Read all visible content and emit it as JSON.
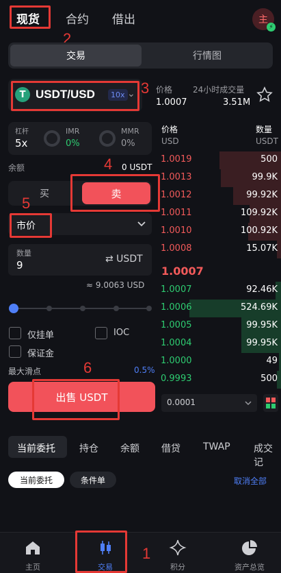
{
  "topnav": {
    "spot": "现货",
    "contract": "合约",
    "lending": "借出",
    "avatar": "主",
    "avatar_badge": "⚡"
  },
  "segment": {
    "trade": "交易",
    "chart": "行情图"
  },
  "pair": {
    "coin_letter": "T",
    "name": "USDT/USD",
    "leverage": "10x",
    "chevron": "⌄"
  },
  "market_info": {
    "price_label": "价格",
    "price": "1.0007",
    "vol_label": "24小时成交量",
    "vol": "3.51M",
    "star_icon": "star-icon"
  },
  "leverage_box": {
    "label": "杠杆",
    "value": "5x",
    "imr_label": "IMR",
    "imr": "0%",
    "mmr_label": "MMR",
    "mmr": "0%"
  },
  "balance": {
    "label": "余额",
    "value": "0 USDT"
  },
  "side": {
    "buy": "买",
    "sell": "卖"
  },
  "order_type": {
    "value": "市价"
  },
  "quantity": {
    "label": "数量",
    "value": "9",
    "unit": "⇄ USDT",
    "approx": "≈ 9.0063 USD"
  },
  "options": {
    "post_only": "仅挂单",
    "ioc": "IOC",
    "margin": "保证金",
    "slippage_label": "最大滑点",
    "slippage": "0.5%"
  },
  "submit": {
    "label": "出售 USDT"
  },
  "orderbook": {
    "price_header": "价格",
    "price_unit": "USD",
    "qty_header": "数量",
    "qty_unit": "USDT",
    "asks": [
      {
        "price": "1.0019",
        "qty": "500"
      },
      {
        "price": "1.0013",
        "qty": "99.9K"
      },
      {
        "price": "1.0012",
        "qty": "99.92K"
      },
      {
        "price": "1.0011",
        "qty": "109.92K"
      },
      {
        "price": "1.0010",
        "qty": "100.92K"
      },
      {
        "price": "1.0008",
        "qty": "15.07K"
      }
    ],
    "mid": "1.0007",
    "bids": [
      {
        "price": "1.0007",
        "qty": "92.46K"
      },
      {
        "price": "1.0006",
        "qty": "524.69K"
      },
      {
        "price": "1.0005",
        "qty": "99.95K"
      },
      {
        "price": "1.0004",
        "qty": "99.95K"
      },
      {
        "price": "1.0000",
        "qty": "49"
      },
      {
        "price": "0.9993",
        "qty": "500"
      }
    ],
    "tick_size": "0.0001"
  },
  "bottom_tabs": {
    "open_orders": "当前委托",
    "positions": "持仓",
    "balance": "余额",
    "loans": "借贷",
    "twap": "TWAP",
    "fills": "成交记"
  },
  "sub_tabs": {
    "open": "当前委托",
    "conditional": "条件单",
    "cancel_all": "取消全部"
  },
  "bnav": {
    "home": "主页",
    "trade": "交易",
    "points": "积分",
    "assets": "资产总览"
  },
  "annotations": {
    "a1": "1",
    "a2": "2",
    "a3": "3",
    "a4": "4",
    "a5": "5",
    "a6": "6"
  },
  "colors": {
    "sell": "#f2525a",
    "buy_green": "#2ecc71",
    "ask_red": "#f25a5a",
    "accent": "#4f7ff7",
    "annotation": "#e53935"
  }
}
